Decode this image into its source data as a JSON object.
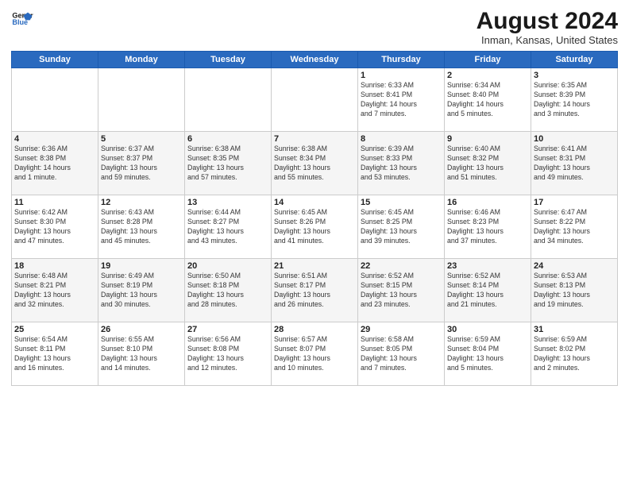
{
  "header": {
    "logo_line1": "General",
    "logo_line2": "Blue",
    "title": "August 2024",
    "subtitle": "Inman, Kansas, United States"
  },
  "days_of_week": [
    "Sunday",
    "Monday",
    "Tuesday",
    "Wednesday",
    "Thursday",
    "Friday",
    "Saturday"
  ],
  "weeks": [
    [
      {
        "day": "",
        "detail": ""
      },
      {
        "day": "",
        "detail": ""
      },
      {
        "day": "",
        "detail": ""
      },
      {
        "day": "",
        "detail": ""
      },
      {
        "day": "1",
        "detail": "Sunrise: 6:33 AM\nSunset: 8:41 PM\nDaylight: 14 hours\nand 7 minutes."
      },
      {
        "day": "2",
        "detail": "Sunrise: 6:34 AM\nSunset: 8:40 PM\nDaylight: 14 hours\nand 5 minutes."
      },
      {
        "day": "3",
        "detail": "Sunrise: 6:35 AM\nSunset: 8:39 PM\nDaylight: 14 hours\nand 3 minutes."
      }
    ],
    [
      {
        "day": "4",
        "detail": "Sunrise: 6:36 AM\nSunset: 8:38 PM\nDaylight: 14 hours\nand 1 minute."
      },
      {
        "day": "5",
        "detail": "Sunrise: 6:37 AM\nSunset: 8:37 PM\nDaylight: 13 hours\nand 59 minutes."
      },
      {
        "day": "6",
        "detail": "Sunrise: 6:38 AM\nSunset: 8:35 PM\nDaylight: 13 hours\nand 57 minutes."
      },
      {
        "day": "7",
        "detail": "Sunrise: 6:38 AM\nSunset: 8:34 PM\nDaylight: 13 hours\nand 55 minutes."
      },
      {
        "day": "8",
        "detail": "Sunrise: 6:39 AM\nSunset: 8:33 PM\nDaylight: 13 hours\nand 53 minutes."
      },
      {
        "day": "9",
        "detail": "Sunrise: 6:40 AM\nSunset: 8:32 PM\nDaylight: 13 hours\nand 51 minutes."
      },
      {
        "day": "10",
        "detail": "Sunrise: 6:41 AM\nSunset: 8:31 PM\nDaylight: 13 hours\nand 49 minutes."
      }
    ],
    [
      {
        "day": "11",
        "detail": "Sunrise: 6:42 AM\nSunset: 8:30 PM\nDaylight: 13 hours\nand 47 minutes."
      },
      {
        "day": "12",
        "detail": "Sunrise: 6:43 AM\nSunset: 8:28 PM\nDaylight: 13 hours\nand 45 minutes."
      },
      {
        "day": "13",
        "detail": "Sunrise: 6:44 AM\nSunset: 8:27 PM\nDaylight: 13 hours\nand 43 minutes."
      },
      {
        "day": "14",
        "detail": "Sunrise: 6:45 AM\nSunset: 8:26 PM\nDaylight: 13 hours\nand 41 minutes."
      },
      {
        "day": "15",
        "detail": "Sunrise: 6:45 AM\nSunset: 8:25 PM\nDaylight: 13 hours\nand 39 minutes."
      },
      {
        "day": "16",
        "detail": "Sunrise: 6:46 AM\nSunset: 8:23 PM\nDaylight: 13 hours\nand 37 minutes."
      },
      {
        "day": "17",
        "detail": "Sunrise: 6:47 AM\nSunset: 8:22 PM\nDaylight: 13 hours\nand 34 minutes."
      }
    ],
    [
      {
        "day": "18",
        "detail": "Sunrise: 6:48 AM\nSunset: 8:21 PM\nDaylight: 13 hours\nand 32 minutes."
      },
      {
        "day": "19",
        "detail": "Sunrise: 6:49 AM\nSunset: 8:19 PM\nDaylight: 13 hours\nand 30 minutes."
      },
      {
        "day": "20",
        "detail": "Sunrise: 6:50 AM\nSunset: 8:18 PM\nDaylight: 13 hours\nand 28 minutes."
      },
      {
        "day": "21",
        "detail": "Sunrise: 6:51 AM\nSunset: 8:17 PM\nDaylight: 13 hours\nand 26 minutes."
      },
      {
        "day": "22",
        "detail": "Sunrise: 6:52 AM\nSunset: 8:15 PM\nDaylight: 13 hours\nand 23 minutes."
      },
      {
        "day": "23",
        "detail": "Sunrise: 6:52 AM\nSunset: 8:14 PM\nDaylight: 13 hours\nand 21 minutes."
      },
      {
        "day": "24",
        "detail": "Sunrise: 6:53 AM\nSunset: 8:13 PM\nDaylight: 13 hours\nand 19 minutes."
      }
    ],
    [
      {
        "day": "25",
        "detail": "Sunrise: 6:54 AM\nSunset: 8:11 PM\nDaylight: 13 hours\nand 16 minutes."
      },
      {
        "day": "26",
        "detail": "Sunrise: 6:55 AM\nSunset: 8:10 PM\nDaylight: 13 hours\nand 14 minutes."
      },
      {
        "day": "27",
        "detail": "Sunrise: 6:56 AM\nSunset: 8:08 PM\nDaylight: 13 hours\nand 12 minutes."
      },
      {
        "day": "28",
        "detail": "Sunrise: 6:57 AM\nSunset: 8:07 PM\nDaylight: 13 hours\nand 10 minutes."
      },
      {
        "day": "29",
        "detail": "Sunrise: 6:58 AM\nSunset: 8:05 PM\nDaylight: 13 hours\nand 7 minutes."
      },
      {
        "day": "30",
        "detail": "Sunrise: 6:59 AM\nSunset: 8:04 PM\nDaylight: 13 hours\nand 5 minutes."
      },
      {
        "day": "31",
        "detail": "Sunrise: 6:59 AM\nSunset: 8:02 PM\nDaylight: 13 hours\nand 2 minutes."
      }
    ]
  ]
}
